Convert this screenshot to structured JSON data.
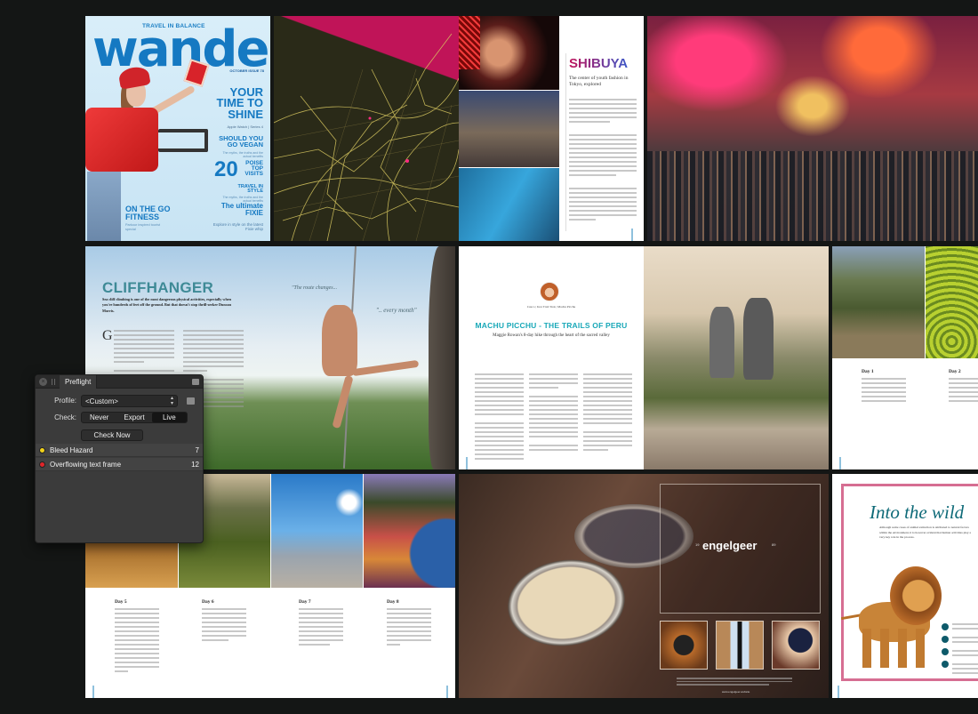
{
  "cover": {
    "tagline": "TRAVEL IN BALANCE",
    "masthead": "wander",
    "issue": "OCTOBER ISSUE 78",
    "headline_1": "YOUR TIME TO SHINE",
    "subline_1": "Apple Watch | Series 4",
    "headline_2": "SHOULD YOU GO VEGAN",
    "subline_2": "The myths, the truths and the actual benefits",
    "headline_3_number": "20",
    "headline_3": "POISE TOP VISITS",
    "headline_4": "TRAVEL IN STYLE",
    "subline_4": "The myths, the truths and the actual benefits",
    "headline_5": "The ultimate FIXIE",
    "subline_5": "Explore in style on the latest Fixie whip",
    "headline_6": "ON THE GO FITNESS",
    "subline_6": "Parkour inspired tourist special"
  },
  "shibuya": {
    "title": "SHIBUYA",
    "subtitle": "The center of youth fashion in Tokyo, explored"
  },
  "cliffhanger": {
    "title": "CLIFFHANGER",
    "lede": "Sea cliff climbing is one of the most dangerous physical activities, especially when you're hundreds of feet off the ground. But that doesn't stop thrill-seeker Duncan Morris.",
    "dropcap": "G",
    "quote_1": "\"The route changes...",
    "quote_2": "\".. every month\""
  },
  "machu_picchu": {
    "byline": "Cusco | Inca Trail Trek | Machu Picchu",
    "title": "MACHU PICCHU - THE TRAILS OF PERU",
    "subtitle": "Maggie Rowan's 8-day hike through the heart of the sacred valley"
  },
  "days_right": {
    "day_1": "Day 1",
    "day_2": "Day 2"
  },
  "days_spread": {
    "day_5": "Day 5",
    "day_6": "Day 6",
    "day_7": "Day 7",
    "day_8": "Day 8"
  },
  "engelgeer": {
    "brand": "engelgeer",
    "sup_left": "19",
    "sup_right": "89",
    "url": "www.engelgeer.website"
  },
  "wild": {
    "title": "Into the wild",
    "lede": "Although some cases of animal extinction is attributed to natural factors within the environment, it is however evident that human activities play a very key role in the process."
  },
  "preflight": {
    "tab_label": "Preflight",
    "profile_label": "Profile:",
    "profile_value": "<Custom>",
    "check_label": "Check:",
    "check_options": [
      "Never",
      "Export",
      "Live"
    ],
    "check_selected": "Live",
    "check_now_label": "Check Now",
    "issues": [
      {
        "name": "Bleed Hazard",
        "count": "7",
        "color": "#f2d21a"
      },
      {
        "name": "Overflowing text frame",
        "count": "12",
        "color": "#e0262a"
      }
    ]
  },
  "colors": {
    "background": "#141615",
    "panel": "#3b3b3b",
    "wander_blue": "#1579c2",
    "cliff_teal": "#3e8a96",
    "machu_teal": "#19a8b8",
    "wild_teal": "#0e6a78",
    "wild_border": "#d66e92"
  }
}
